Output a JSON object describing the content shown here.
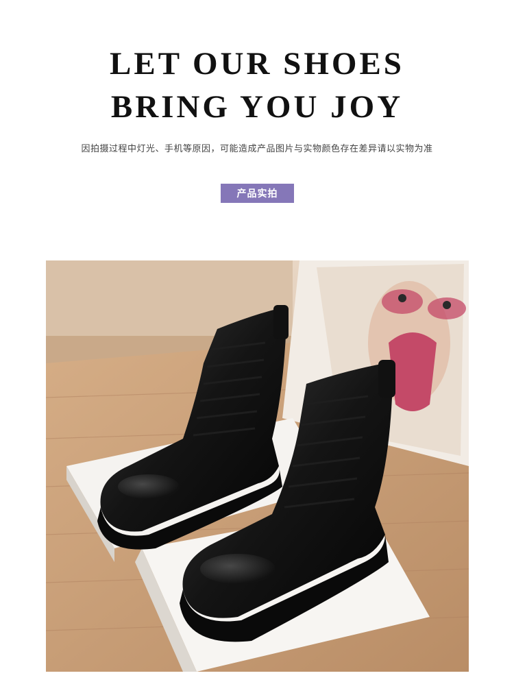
{
  "header": {
    "title_line1": "LET OUR SHOES",
    "title_line2": "BRING YOU JOY",
    "disclaimer": "因拍摄过程中灯光、手机等原因，可能造成产品图片与实物颜色存在差异请以实物为准"
  },
  "section": {
    "badge_label": "产品实拍"
  },
  "photo": {
    "subject": "black-leather-lace-up-ankle-boots",
    "colors": {
      "floor": "#c99f77",
      "wall": "#e0cbb7",
      "leather": "#1a1a1a",
      "box": "#f4f2ef",
      "poster_bg": "#eadfd4",
      "poster_accent": "#c44a68"
    }
  },
  "theme": {
    "badge_color": "#8577b8",
    "text_color": "#111111"
  }
}
